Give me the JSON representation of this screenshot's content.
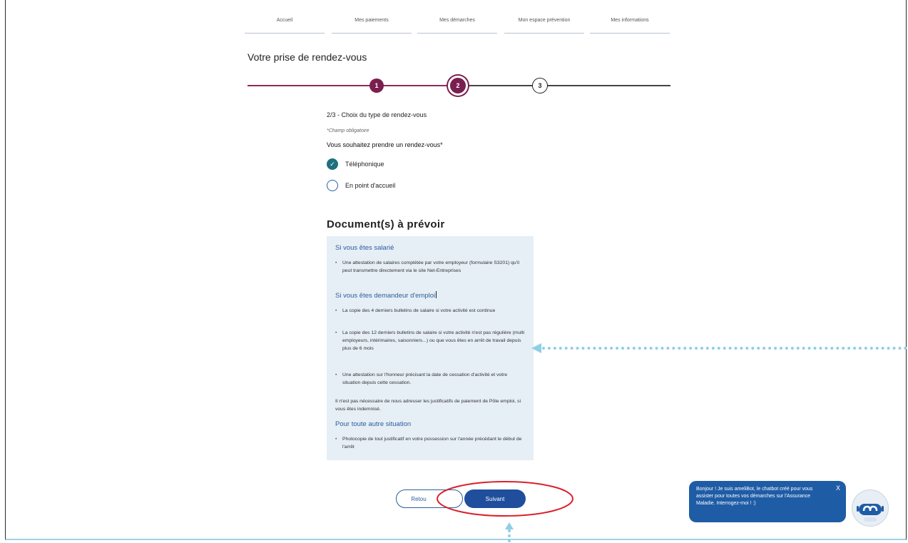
{
  "nav": {
    "items": [
      "Accueil",
      "Mes paiements",
      "Mes démarches",
      "Mon espace prévention",
      "Mes informations"
    ]
  },
  "page": {
    "title": "Votre prise de rendez-vous"
  },
  "stepper": {
    "steps": [
      "1",
      "2",
      "3"
    ],
    "current": 2
  },
  "form": {
    "step_heading": "2/3 - Choix du type de rendez-vous",
    "required_note": "*Champ obligatoire",
    "question": "Vous souhaitez prendre un rendez-vous*",
    "options": [
      {
        "label": "Téléphonique",
        "selected": true
      },
      {
        "label": "En point d'accueil",
        "selected": false
      }
    ]
  },
  "documents": {
    "title": "Document(s) à prévoir",
    "sections": [
      {
        "heading": "Si vous êtes salarié",
        "items": [
          "Une attestation de salaires complétée par votre employeur (formulaire S3201) qu'il peut transmettre directement via le site Net-Entreprises"
        ]
      },
      {
        "heading": "Si vous êtes demandeur d'emploi",
        "items": [
          "La copie des 4 derniers bulletins de salaire si votre activité est continue",
          "La copie des 12 derniers bulletins de salaire si votre activité n'est pas régulière (multi employeurs, intérimaires, saisonniers...) ou que vous êtes en arrêt de travail depuis plus de 6 mois",
          "Une attestation sur l'honneur précisant la date de cessation d'activité et votre situation depuis cette cessation."
        ],
        "note": "Il n'est pas nécessaire de nous adresser les justificatifs de paiement de Pôle emploi, si vous êtes indemnisé."
      },
      {
        "heading": "Pour toute autre situation",
        "items": [
          "Photocopie de tout justificatif en votre possession sur l'année précédant le début de l'arrêt"
        ]
      }
    ]
  },
  "buttons": {
    "back": "Retou",
    "next": "Suivant"
  },
  "chatbot": {
    "message": "Bonjour ! Je suis ameliBot, le chatbot créé pour vous assister pour toutes vos démarches sur l'Assurance Maladie. Interrogez-moi ! :)",
    "close": "X"
  },
  "colors": {
    "step_active": "#7a1f4f",
    "primary_button": "#1f4e9c",
    "annotation": "#8fcfe6",
    "highlight_ellipse": "#d9202a"
  }
}
